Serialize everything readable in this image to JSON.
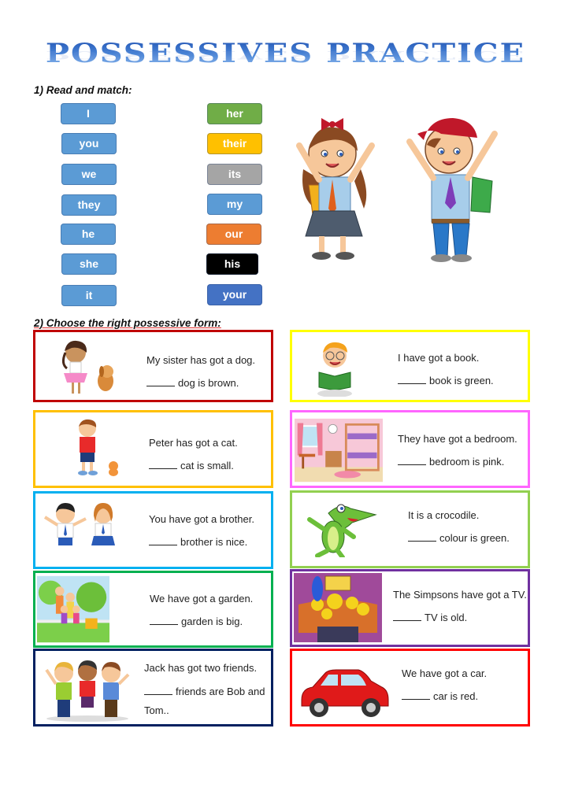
{
  "worksheet": {
    "title": "POSSESSIVES PRACTICE",
    "section1": {
      "heading": "1) Read and match:",
      "subject_pronouns": [
        "I",
        "you",
        "we",
        "they",
        "he",
        "she",
        "it"
      ],
      "possessive_adjectives": [
        {
          "label": "her",
          "color": "#70ad47"
        },
        {
          "label": "their",
          "color": "#ffc000"
        },
        {
          "label": "its",
          "color": "#a5a5a5"
        },
        {
          "label": "my",
          "color": "#5b9bd5"
        },
        {
          "label": "our",
          "color": "#ed7d31"
        },
        {
          "label": "his",
          "color": "#000000"
        },
        {
          "label": "your",
          "color": "#4472c4"
        }
      ],
      "image": "two-school-kids-waving"
    },
    "section2": {
      "heading": "2) Choose the right possessive form:",
      "exercises": [
        {
          "sentence": "My sister has got a dog.",
          "blank": "_____",
          "completion": "dog is brown.",
          "border": "#c00000",
          "image": "girl-with-dog"
        },
        {
          "sentence": "I have got a book.",
          "blank": "_____",
          "completion": "book is green.",
          "border": "#ffff00",
          "image": "boy-reading-book"
        },
        {
          "sentence": "Peter has got a cat.",
          "blank": "_____",
          "completion": "cat is small.",
          "border": "#ffc000",
          "image": "boy-with-cat"
        },
        {
          "sentence": "They have got a bedroom.",
          "blank": "_____",
          "completion": "bedroom is pink.",
          "border": "#ff66ff",
          "image": "pink-bedroom"
        },
        {
          "sentence": "You have got a brother.",
          "blank": "_____",
          "completion": "brother is nice.",
          "border": "#00b0f0",
          "image": "boy-and-girl"
        },
        {
          "sentence": "It is a crocodile.",
          "blank": "_____",
          "completion": "colour is green.",
          "border": "#92d050",
          "image": "crocodile"
        },
        {
          "sentence": "We have got a garden.",
          "blank": "_____",
          "completion": "garden is big.",
          "border": "#00b050",
          "image": "family-in-garden"
        },
        {
          "sentence": "The Simpsons have got a TV.",
          "blank": "_____",
          "completion": "TV is old.",
          "border": "#7030a0",
          "image": "simpsons-watching-tv"
        },
        {
          "sentence": "Jack has got two friends.",
          "blank": "_____",
          "completion": "friends are Bob and Tom..",
          "border": "#002060",
          "image": "three-boys"
        },
        {
          "sentence": "We have got a car.",
          "blank": "_____",
          "completion": "car is red.",
          "border": "#ff0000",
          "image": "red-car"
        }
      ]
    }
  }
}
